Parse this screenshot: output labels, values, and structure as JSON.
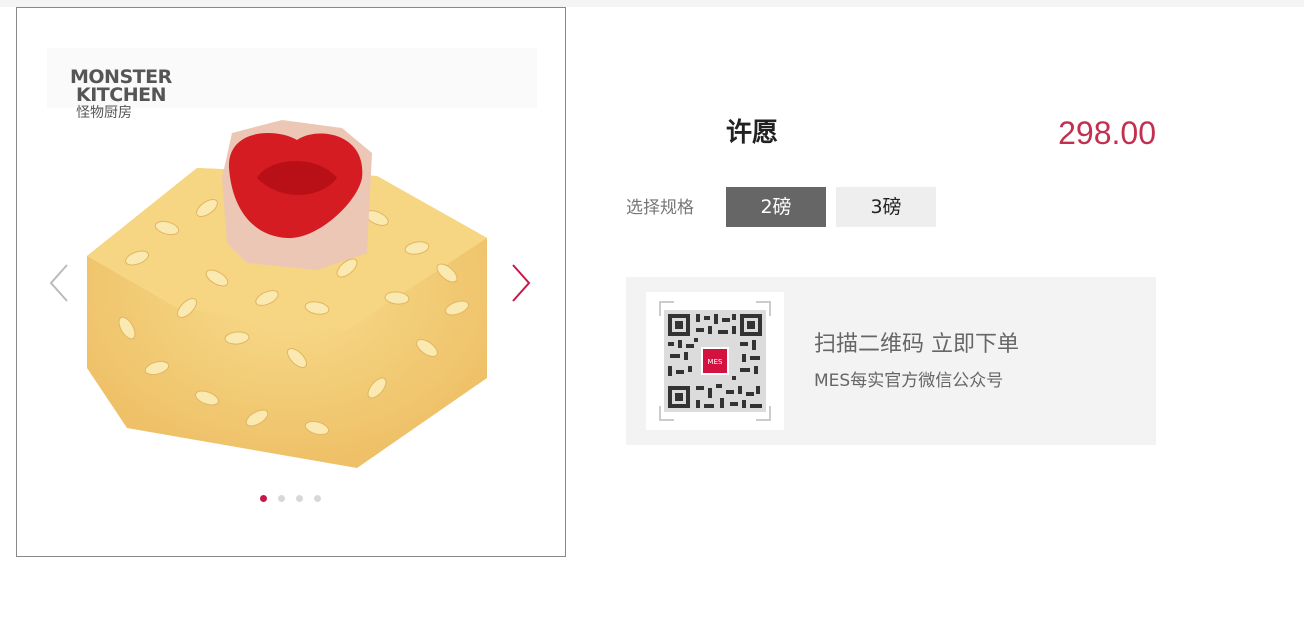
{
  "gallery": {
    "brand_line1": "MONSTER",
    "brand_line2": "KITCHEN",
    "brand_line3": "怪物厨房",
    "slide_count": 4,
    "active_slide": 1,
    "prev_icon": "chevron-left-icon",
    "next_icon": "chevron-right-icon"
  },
  "product": {
    "title": "许愿",
    "price": "298.00",
    "spec_label": "选择规格",
    "specs": [
      {
        "label": "2磅",
        "selected": true
      },
      {
        "label": "3磅",
        "selected": false
      }
    ]
  },
  "qr": {
    "badge_text": "MES",
    "title": "扫描二维码 立即下单",
    "subtitle": "MES每实官方微信公众号"
  },
  "colors": {
    "accent": "#c8174b",
    "price": "#c2304f",
    "spec_active_bg": "#666666",
    "spec_inactive_bg": "#eeeeee",
    "panel_bg": "#f3f3f3"
  }
}
